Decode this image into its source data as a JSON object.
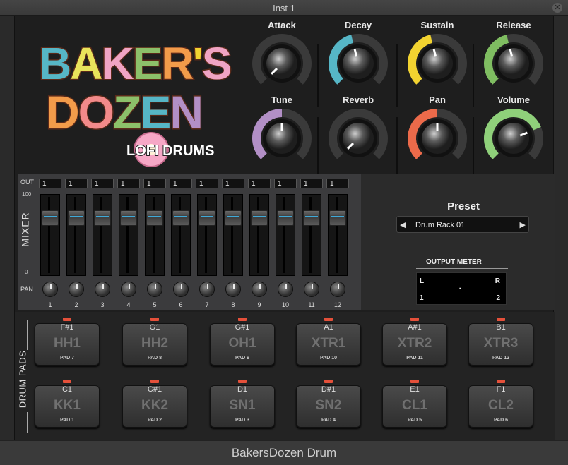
{
  "window": {
    "title": "Inst 1",
    "footer": "BakersDozen Drum"
  },
  "logo": {
    "line1": "BAKER'S",
    "line2": "DOZEN",
    "subtitle": "LOFI DRUMS"
  },
  "colors": {
    "knob_gray": "#3a3a3a",
    "decay": "#56b6c6",
    "sustain": "#f2d330",
    "release": "#7fbd61",
    "tune": "#b28fc6",
    "pan": "#ec6a4a",
    "volume": "#8fd07a",
    "led": "#e4503a",
    "fader_stripe": "#3fa9d8"
  },
  "knobs": [
    {
      "label": "Attack",
      "level": 0.0,
      "color": "#3a3a3a"
    },
    {
      "label": "Decay",
      "level": 0.45,
      "color": "#56b6c6"
    },
    {
      "label": "Sustain",
      "level": 0.45,
      "color": "#f2d330"
    },
    {
      "label": "Release",
      "level": 0.45,
      "color": "#7fbd61"
    },
    {
      "label": "Tune",
      "level": 0.5,
      "color": "#b28fc6"
    },
    {
      "label": "Reverb",
      "level": 0.0,
      "color": "#3a3a3a"
    },
    {
      "label": "Pan",
      "level": 0.5,
      "color": "#ec6a4a"
    },
    {
      "label": "Volume",
      "level": 0.75,
      "color": "#8fd07a"
    }
  ],
  "mixer": {
    "label": "MIXER",
    "out_label": "OUT",
    "max_label": "100",
    "min_label": "0",
    "pan_label": "PAN",
    "channels": [
      {
        "out": "1",
        "num": "1",
        "level": 0.78
      },
      {
        "out": "1",
        "num": "2",
        "level": 0.78
      },
      {
        "out": "1",
        "num": "3",
        "level": 0.78
      },
      {
        "out": "1",
        "num": "4",
        "level": 0.78
      },
      {
        "out": "1",
        "num": "5",
        "level": 0.78
      },
      {
        "out": "1",
        "num": "6",
        "level": 0.78
      },
      {
        "out": "1",
        "num": "7",
        "level": 0.78
      },
      {
        "out": "1",
        "num": "8",
        "level": 0.78
      },
      {
        "out": "1",
        "num": "9",
        "level": 0.78
      },
      {
        "out": "1",
        "num": "10",
        "level": 0.78
      },
      {
        "out": "1",
        "num": "11",
        "level": 0.78
      },
      {
        "out": "1",
        "num": "12",
        "level": 0.78
      }
    ]
  },
  "preset": {
    "title": "Preset",
    "value": "Drum Rack 01",
    "prev": "◀",
    "next": "▶"
  },
  "output_meter": {
    "title": "OUTPUT METER",
    "left": "L",
    "right": "R",
    "value": "-",
    "ch1": "1",
    "ch2": "2"
  },
  "pads": {
    "label": "DRUM PADS",
    "top_row": [
      {
        "note": "F#1",
        "name": "HH1",
        "pad": "PAD 7"
      },
      {
        "note": "G1",
        "name": "HH2",
        "pad": "PAD 8"
      },
      {
        "note": "G#1",
        "name": "OH1",
        "pad": "PAD 9"
      },
      {
        "note": "A1",
        "name": "XTR1",
        "pad": "PAD 10"
      },
      {
        "note": "A#1",
        "name": "XTR2",
        "pad": "PAD 11"
      },
      {
        "note": "B1",
        "name": "XTR3",
        "pad": "PAD 12"
      }
    ],
    "bottom_row": [
      {
        "note": "C1",
        "name": "KK1",
        "pad": "PAD 1"
      },
      {
        "note": "C#1",
        "name": "KK2",
        "pad": "PAD 2"
      },
      {
        "note": "D1",
        "name": "SN1",
        "pad": "PAD 3"
      },
      {
        "note": "D#1",
        "name": "SN2",
        "pad": "PAD 4"
      },
      {
        "note": "E1",
        "name": "CL1",
        "pad": "PAD 5"
      },
      {
        "note": "F1",
        "name": "CL2",
        "pad": "PAD 6"
      }
    ]
  }
}
